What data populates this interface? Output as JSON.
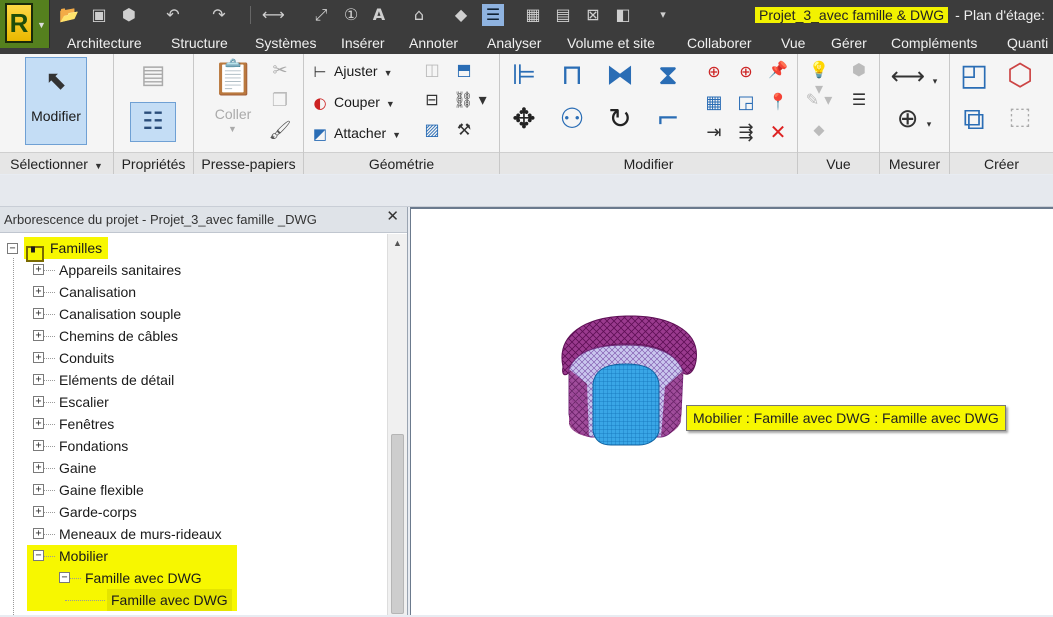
{
  "title": {
    "project": "Projet_3_avec famille & DWG",
    "view": " - Plan d'étage:"
  },
  "app": {
    "logo_letter": "R"
  },
  "tabs": [
    "Architecture",
    "Structure",
    "Systèmes",
    "Insérer",
    "Annoter",
    "Analyser",
    "Volume et site",
    "Collaborer",
    "Vue",
    "Gérer",
    "Compléments",
    "Quanti"
  ],
  "ribbon": {
    "modifier_label": "Modifier",
    "coller_label": "Coller",
    "geometry": {
      "ajuster": "Ajuster",
      "couper": "Couper",
      "attacher": "Attacher"
    },
    "panels": {
      "selectionner": "Sélectionner",
      "proprietes": "Propriétés",
      "presse_papiers": "Presse-papiers",
      "geometrie": "Géométrie",
      "modifier": "Modifier",
      "vue": "Vue",
      "mesurer": "Mesurer",
      "creer": "Créer"
    }
  },
  "browser": {
    "title": "Arborescence du projet - Projet_3_avec famille _DWG",
    "root": "Familles",
    "items": [
      "Appareils sanitaires",
      "Canalisation",
      "Canalisation souple",
      "Chemins de câbles",
      "Conduits",
      "Eléments de détail",
      "Escalier",
      "Fenêtres",
      "Fondations",
      "Gaine",
      "Gaine flexible",
      "Garde-corps",
      "Meneaux de murs-rideaux"
    ],
    "expanded": {
      "category": "Mobilier",
      "family": "Famille avec DWG",
      "type": "Famille avec DWG"
    }
  },
  "canvas": {
    "tooltip": "Mobilier : Famille avec DWG : Famille avec DWG"
  },
  "colors": {
    "highlight": "#f7f700",
    "mesh_dark": "#7a1a6e",
    "mesh_light": "#1e90d8"
  }
}
